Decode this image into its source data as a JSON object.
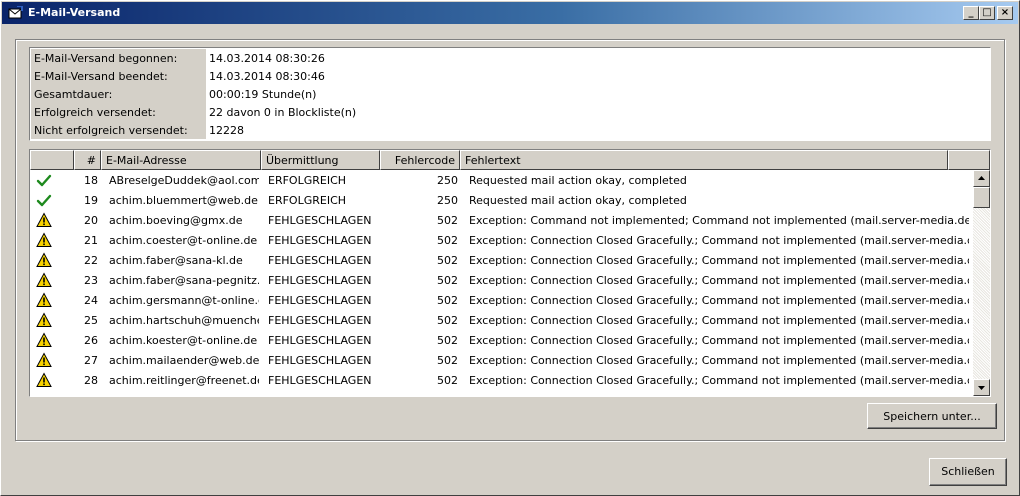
{
  "window": {
    "title": "E-Mail-Versand"
  },
  "titlebar_buttons": {
    "minimize": "_",
    "maximize": "□",
    "close": "×"
  },
  "info": [
    {
      "label": "E-Mail-Versand begonnen:",
      "value": "14.03.2014 08:30:26"
    },
    {
      "label": "E-Mail-Versand beendet:",
      "value": "14.03.2014 08:30:46"
    },
    {
      "label": "Gesamtdauer:",
      "value": "00:00:19 Stunde(n)"
    },
    {
      "label": "Erfolgreich versendet:",
      "value": "22 davon 0 in Blockliste(n)"
    },
    {
      "label": "Nicht erfolgreich versendet:",
      "value": "12228"
    }
  ],
  "table": {
    "columns": [
      "",
      "#",
      "E-Mail-Adresse",
      "Übermittlung",
      "Fehlercode",
      "Fehlertext"
    ],
    "rows": [
      {
        "icon": "check-icon",
        "num": "18",
        "email": "ABreselgeDuddek@aol.com",
        "status": "ERFOLGREICH",
        "code": "250",
        "text": "Requested mail action okay, completed"
      },
      {
        "icon": "check-icon",
        "num": "19",
        "email": "achim.bluemmert@web.de",
        "status": "ERFOLGREICH",
        "code": "250",
        "text": "Requested mail action okay, completed"
      },
      {
        "icon": "warning-icon",
        "num": "20",
        "email": "achim.boeving@gmx.de",
        "status": "FEHLGESCHLAGEN",
        "code": "502",
        "text": "Exception: Command not implemented; Command not implemented (mail.server-media.de)"
      },
      {
        "icon": "warning-icon",
        "num": "21",
        "email": "achim.coester@t-online.de",
        "status": "FEHLGESCHLAGEN",
        "code": "502",
        "text": "Exception: Connection Closed Gracefully.; Command not implemented (mail.server-media.de)"
      },
      {
        "icon": "warning-icon",
        "num": "22",
        "email": "achim.faber@sana-kl.de",
        "status": "FEHLGESCHLAGEN",
        "code": "502",
        "text": "Exception: Connection Closed Gracefully.; Command not implemented (mail.server-media.de)"
      },
      {
        "icon": "warning-icon",
        "num": "23",
        "email": "achim.faber@sana-pegnitz.de",
        "status": "FEHLGESCHLAGEN",
        "code": "502",
        "text": "Exception: Connection Closed Gracefully.; Command not implemented (mail.server-media.de)"
      },
      {
        "icon": "warning-icon",
        "num": "24",
        "email": "achim.gersmann@t-online.de",
        "status": "FEHLGESCHLAGEN",
        "code": "502",
        "text": "Exception: Connection Closed Gracefully.; Command not implemented (mail.server-media.de)"
      },
      {
        "icon": "warning-icon",
        "num": "25",
        "email": "achim.hartschuh@muenche…",
        "status": "FEHLGESCHLAGEN",
        "code": "502",
        "text": "Exception: Connection Closed Gracefully.; Command not implemented (mail.server-media.de)"
      },
      {
        "icon": "warning-icon",
        "num": "26",
        "email": "achim.koester@t-online.de",
        "status": "FEHLGESCHLAGEN",
        "code": "502",
        "text": "Exception: Connection Closed Gracefully.; Command not implemented (mail.server-media.de)"
      },
      {
        "icon": "warning-icon",
        "num": "27",
        "email": "achim.mailaender@web.de",
        "status": "FEHLGESCHLAGEN",
        "code": "502",
        "text": "Exception: Connection Closed Gracefully.; Command not implemented (mail.server-media.de)"
      },
      {
        "icon": "warning-icon",
        "num": "28",
        "email": "achim.reitlinger@freenet.de",
        "status": "FEHLGESCHLAGEN",
        "code": "502",
        "text": "Exception: Connection Closed Gracefully.; Command not implemented (mail.server-media.de)"
      }
    ]
  },
  "buttons": {
    "save_as": "Speichern unter...",
    "close": "Schließen"
  },
  "colors": {
    "check": "#1e8a1e",
    "warning_fill": "#f7d200",
    "warning_border": "#000000"
  }
}
